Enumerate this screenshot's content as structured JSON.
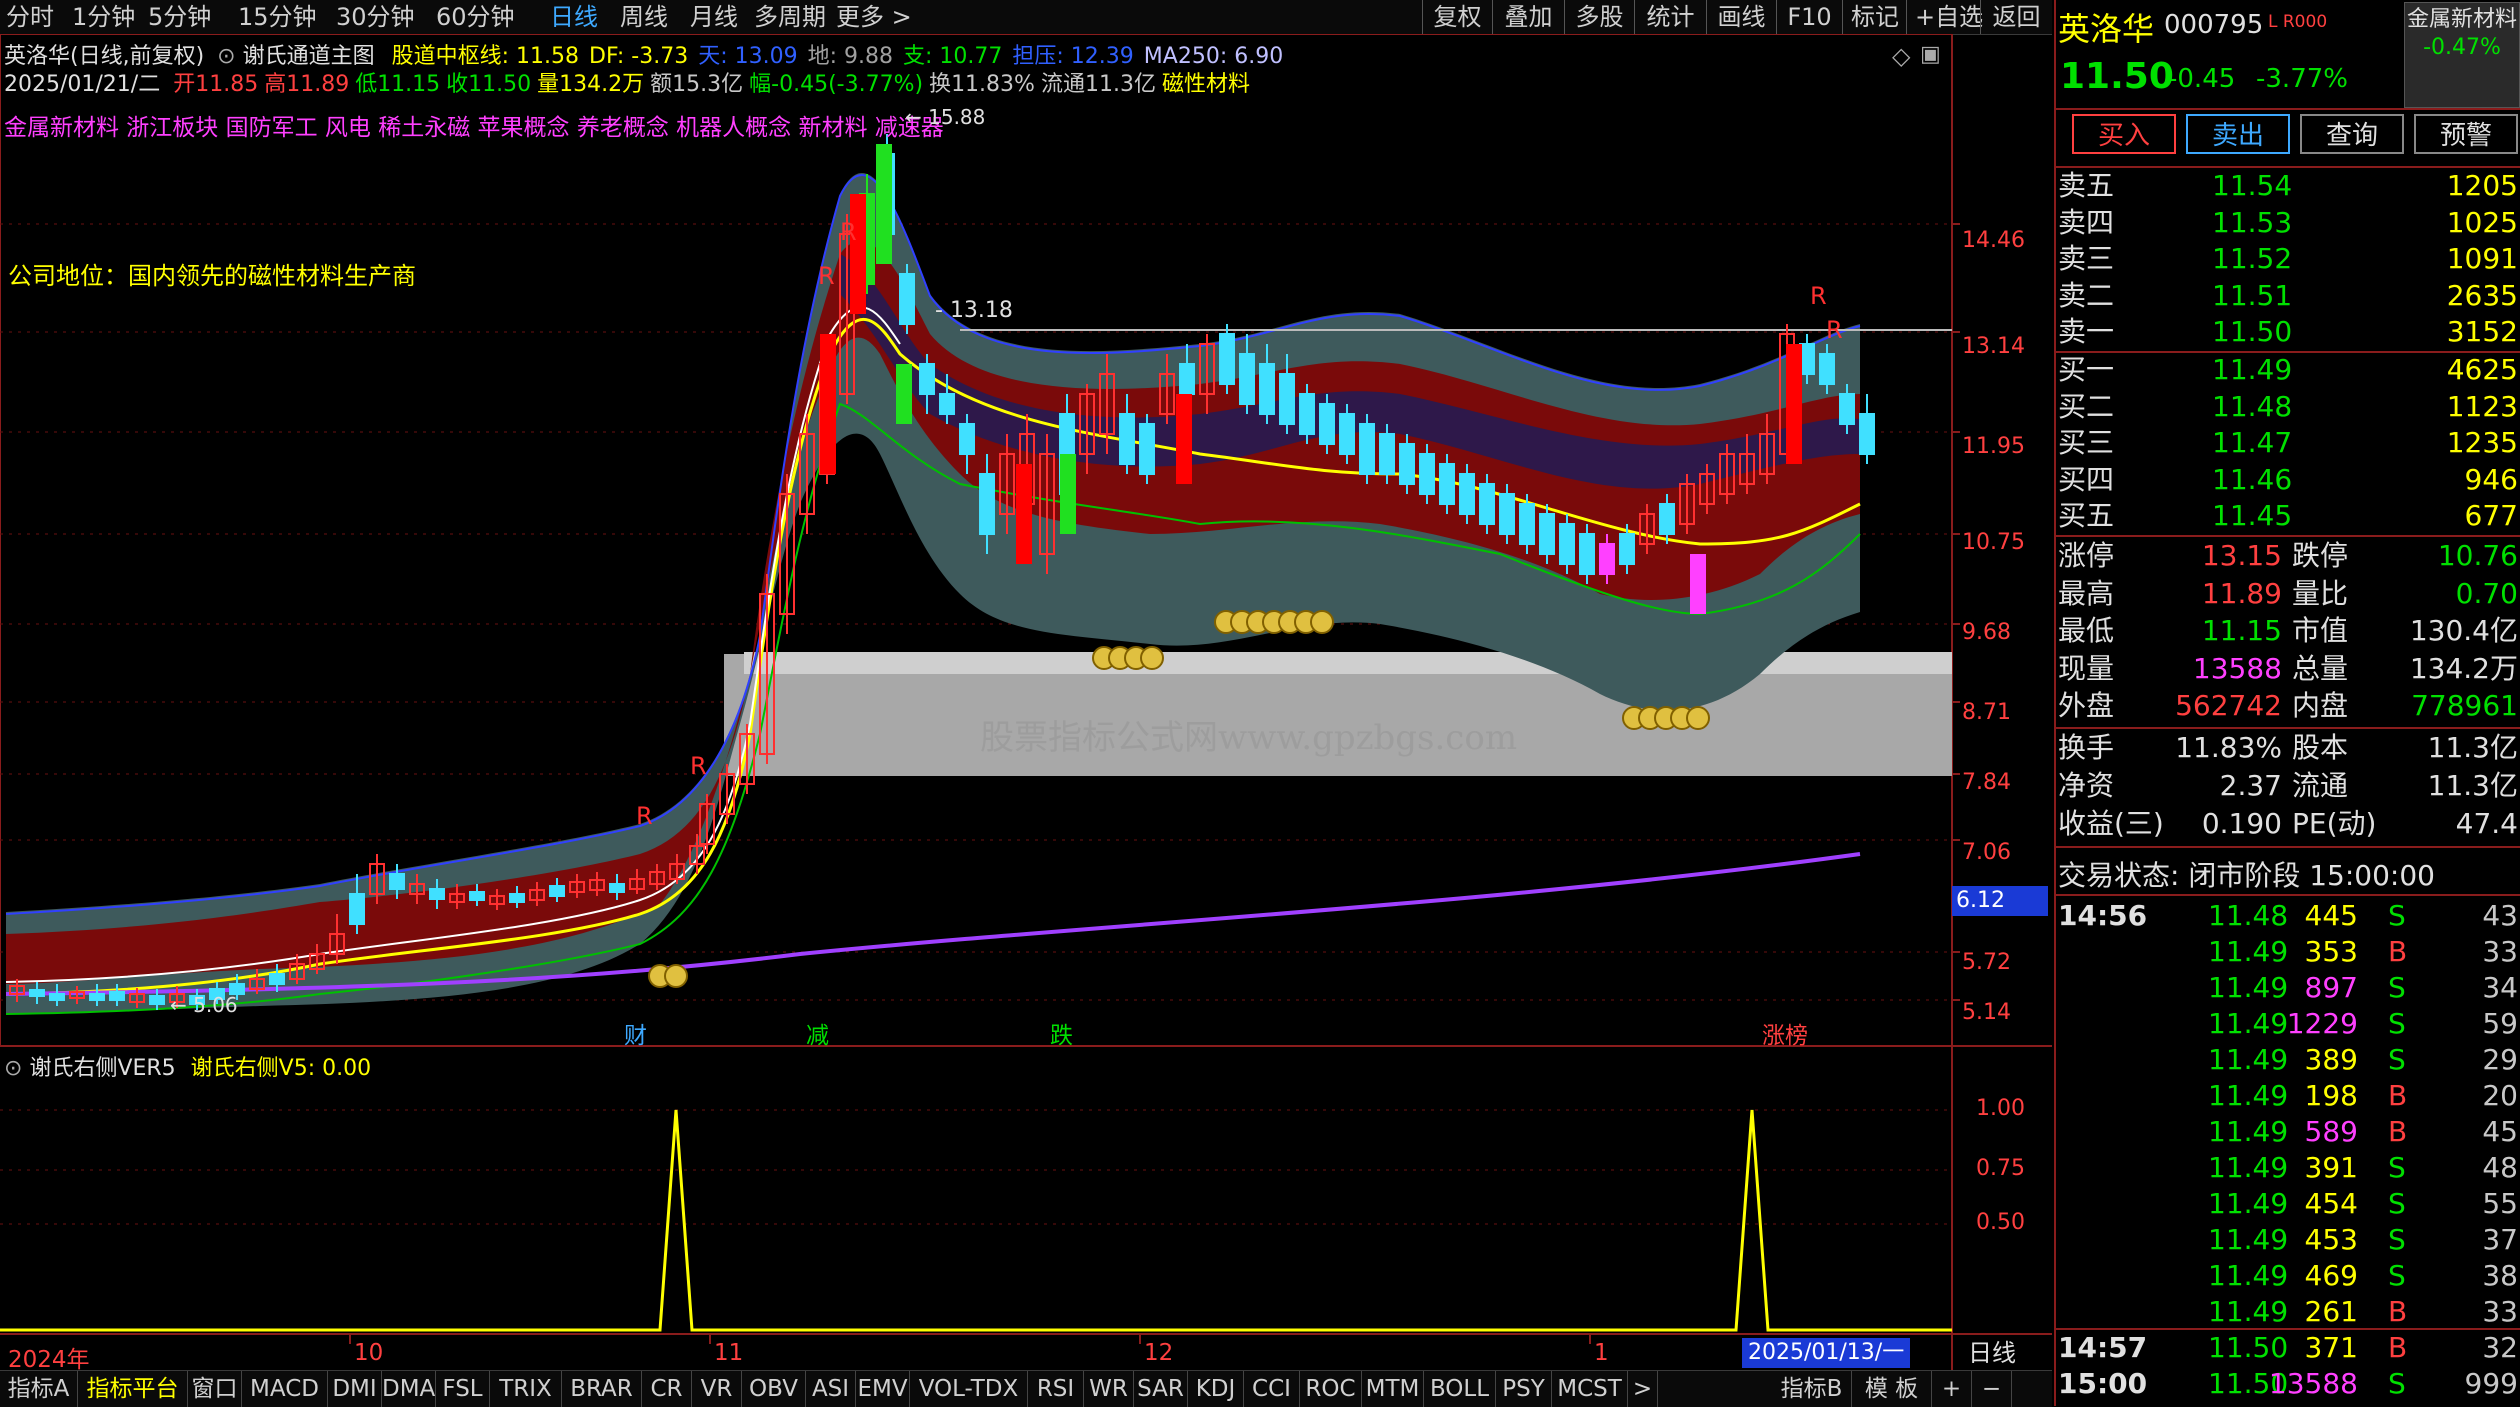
{
  "toolbar": {
    "periods": [
      "分时",
      "1分钟",
      "5分钟",
      "15分钟",
      "30分钟",
      "60分钟",
      "日线",
      "周线",
      "月线",
      "多周期",
      "更多 >"
    ],
    "active_period": "日线",
    "right_buttons": [
      "复权",
      "叠加",
      "多股",
      "统计",
      "画线",
      "F10",
      "标记",
      "+自选",
      "返回"
    ]
  },
  "chart_header": {
    "line1_title": "英洛华(日线,前复权)",
    "line1_indicator": "谢氏通道主图",
    "line1_values": [
      {
        "text": "股道中枢线: 11.58",
        "color": "#ffff00"
      },
      {
        "text": "DF: -3.73",
        "color": "#ffff00"
      },
      {
        "text": "天: 13.09",
        "color": "#3060ff"
      },
      {
        "text": "地: 9.88",
        "color": "#a0a0a0"
      },
      {
        "text": "支: 10.77",
        "color": "#00e000"
      },
      {
        "text": "担压: 12.39",
        "color": "#3060ff"
      },
      {
        "text": "MA250: 6.90",
        "color": "#c0c0ff"
      }
    ],
    "line2_date": "2025/01/21/二",
    "line2_values": [
      {
        "text": "开11.85",
        "color": "#ff4040"
      },
      {
        "text": "高11.89",
        "color": "#ff4040"
      },
      {
        "text": "低11.15",
        "color": "#00e000"
      },
      {
        "text": "收11.50",
        "color": "#00e000"
      },
      {
        "text": "量134.2万",
        "color": "#ffff00"
      },
      {
        "text": "额15.3亿",
        "color": "#c8c8c8"
      },
      {
        "text": "幅-0.45(-3.77%)",
        "color": "#00e000"
      },
      {
        "text": "换11.83%",
        "color": "#c8c8c8"
      },
      {
        "text": "流通11.3亿",
        "color": "#c8c8c8"
      },
      {
        "text": "磁性材料",
        "color": "#ffff00"
      }
    ],
    "concepts": "金属新材料 浙江板块 国防军工 风电 稀土永磁 苹果概念 养老概念 机器人概念 新材料 减速器",
    "company_position": "公司地位：国内领先的磁性材料生产商",
    "high_label": "15.88",
    "low_label": "5.06",
    "level_label": "13.18",
    "watermark": "股票指标公式网www.gpzbgs.com"
  },
  "price_axis": {
    "ticks": [
      "14.46",
      "13.14",
      "11.95",
      "10.75",
      "9.68",
      "8.71",
      "7.84",
      "7.06",
      "5.72",
      "5.14"
    ],
    "current_label": "6.12"
  },
  "event_labels": [
    {
      "text": "财",
      "color": "#3ea9ff"
    },
    {
      "text": "减",
      "color": "#00e000"
    },
    {
      "text": "跌",
      "color": "#00e000"
    },
    {
      "text": "涨榜",
      "color": "#ff4040"
    }
  ],
  "sub_chart": {
    "title": "谢氏右侧VER5",
    "value": "谢氏右侧V5: 0.00",
    "ticks": [
      "1.00",
      "0.75",
      "0.50"
    ]
  },
  "date_axis": {
    "labels": [
      "2024年",
      "10",
      "11",
      "12",
      "1"
    ],
    "cursor_date": "2025/01/13/一",
    "period": "日线"
  },
  "bottom_tabs": [
    "指标A",
    "指标平台",
    "窗口",
    "MACD",
    "DMI",
    "DMA",
    "FSL",
    "TRIX",
    "BRAR",
    "CR",
    "VR",
    "OBV",
    "ASI",
    "EMV",
    "VOL-TDX",
    "RSI",
    "WR",
    "SAR",
    "KDJ",
    "CCI",
    "ROC",
    "MTM",
    "BOLL",
    "PSY",
    "MCST",
    ">",
    "指标B",
    "模 板",
    "+",
    "−"
  ],
  "stock": {
    "name": "英洛华",
    "code": "000795",
    "flags": "L R000",
    "price": "11.50",
    "change": "-0.45",
    "pct": "-3.77%",
    "sector": "金属新材料",
    "sector_pct": "-0.47%"
  },
  "actions": [
    "买入",
    "卖出",
    "查询",
    "预警"
  ],
  "order_book": {
    "asks": [
      {
        "label": "卖五",
        "price": "11.54",
        "vol": "1205"
      },
      {
        "label": "卖四",
        "price": "11.53",
        "vol": "1025"
      },
      {
        "label": "卖三",
        "price": "11.52",
        "vol": "1091"
      },
      {
        "label": "卖二",
        "price": "11.51",
        "vol": "2635"
      },
      {
        "label": "卖一",
        "price": "11.50",
        "vol": "3152"
      }
    ],
    "bids": [
      {
        "label": "买一",
        "price": "11.49",
        "vol": "4625"
      },
      {
        "label": "买二",
        "price": "11.48",
        "vol": "1123"
      },
      {
        "label": "买三",
        "price": "11.47",
        "vol": "1235"
      },
      {
        "label": "买四",
        "price": "11.46",
        "vol": "946"
      },
      {
        "label": "买五",
        "price": "11.45",
        "vol": "677"
      }
    ]
  },
  "stats": [
    {
      "l1": "涨停",
      "v1": "13.15",
      "c1": "#ff4040",
      "l2": "跌停",
      "v2": "10.76",
      "c2": "#00e000"
    },
    {
      "l1": "最高",
      "v1": "11.89",
      "c1": "#ff4040",
      "l2": "量比",
      "v2": "0.70",
      "c2": "#00e000"
    },
    {
      "l1": "最低",
      "v1": "11.15",
      "c1": "#00e000",
      "l2": "市值",
      "v2": "130.4亿",
      "c2": "#e0e0e0"
    },
    {
      "l1": "现量",
      "v1": "13588",
      "c1": "#ff40ff",
      "l2": "总量",
      "v2": "134.2万",
      "c2": "#e0e0e0"
    },
    {
      "l1": "外盘",
      "v1": "562742",
      "c1": "#ff4040",
      "l2": "内盘",
      "v2": "778961",
      "c2": "#00e000"
    }
  ],
  "stats2": [
    {
      "l1": "换手",
      "v1": "11.83%",
      "l2": "股本",
      "v2": "11.3亿"
    },
    {
      "l1": "净资",
      "v1": "2.37",
      "l2": "流通",
      "v2": "11.3亿"
    },
    {
      "l1": "收益(三)",
      "v1": "0.190",
      "l2": "PE(动)",
      "v2": "47.4"
    }
  ],
  "trade_status": "交易状态: 闭市阶段 15:00:00",
  "ticks": [
    {
      "time": "14:56",
      "price": "11.48",
      "vol": "445",
      "vc": "#ffff00",
      "side": "S",
      "n": "43"
    },
    {
      "time": "",
      "price": "11.49",
      "vol": "353",
      "vc": "#ffff00",
      "side": "B",
      "n": "33"
    },
    {
      "time": "",
      "price": "11.49",
      "vol": "897",
      "vc": "#ff40ff",
      "side": "S",
      "n": "34"
    },
    {
      "time": "",
      "price": "11.49",
      "vol": "1229",
      "vc": "#ff40ff",
      "side": "S",
      "n": "59"
    },
    {
      "time": "",
      "price": "11.49",
      "vol": "389",
      "vc": "#ffff00",
      "side": "S",
      "n": "29"
    },
    {
      "time": "",
      "price": "11.49",
      "vol": "198",
      "vc": "#ffff00",
      "side": "B",
      "n": "20"
    },
    {
      "time": "",
      "price": "11.49",
      "vol": "589",
      "vc": "#ff40ff",
      "side": "B",
      "n": "45"
    },
    {
      "time": "",
      "price": "11.49",
      "vol": "391",
      "vc": "#ffff00",
      "side": "S",
      "n": "48"
    },
    {
      "time": "",
      "price": "11.49",
      "vol": "454",
      "vc": "#ffff00",
      "side": "S",
      "n": "55"
    },
    {
      "time": "",
      "price": "11.49",
      "vol": "453",
      "vc": "#ffff00",
      "side": "S",
      "n": "37"
    },
    {
      "time": "",
      "price": "11.49",
      "vol": "469",
      "vc": "#ffff00",
      "side": "S",
      "n": "38"
    },
    {
      "time": "",
      "price": "11.49",
      "vol": "261",
      "vc": "#ffff00",
      "side": "B",
      "n": "33"
    },
    {
      "time": "14:57",
      "price": "11.50",
      "vol": "371",
      "vc": "#ffff00",
      "side": "B",
      "n": "32"
    },
    {
      "time": "15:00",
      "price": "11.50",
      "vol": "13588",
      "vc": "#ff40ff",
      "side": "S",
      "n": "999"
    }
  ]
}
